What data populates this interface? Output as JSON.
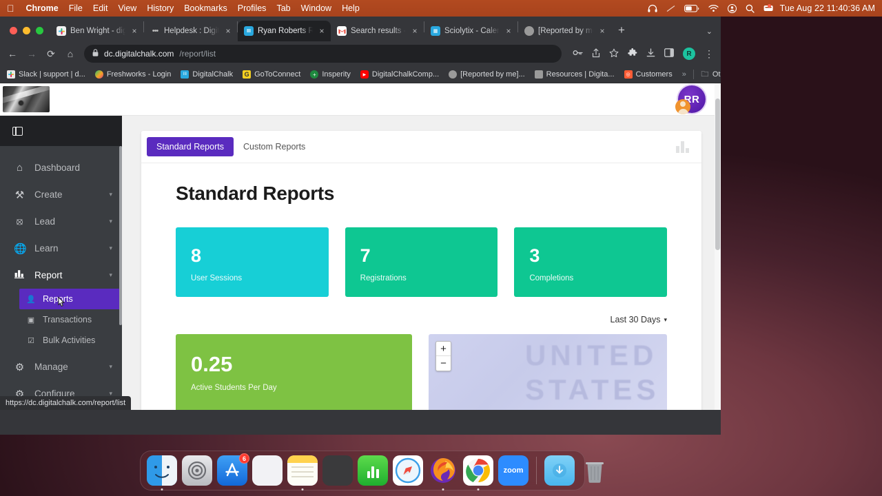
{
  "menubar": {
    "apple": "",
    "items": [
      "Chrome",
      "File",
      "Edit",
      "View",
      "History",
      "Bookmarks",
      "Profiles",
      "Tab",
      "Window",
      "Help"
    ],
    "status_icons": [
      "headphones-icon",
      "screen-mirroring-icon",
      "battery-icon",
      "wifi-icon",
      "control-center-icon",
      "spotlight-search-icon",
      "notification-center-icon"
    ],
    "clock": "Tue Aug 22  11:40:36 AM"
  },
  "browser": {
    "tabs": [
      {
        "title": "Ben Wright - digitalchalk",
        "favicon": "slack-icon",
        "active": false
      },
      {
        "title": "Helpdesk : DigitalChalk",
        "favicon": "freshworks-icon",
        "active": false
      },
      {
        "title": "Ryan Roberts Reports",
        "favicon": "digitalchalk-icon",
        "active": true
      },
      {
        "title": "Search results - ryan.rob",
        "favicon": "gmail-icon",
        "active": false
      },
      {
        "title": "Sciolytix - Calendar - Au",
        "favicon": "calendar-icon",
        "active": false
      },
      {
        "title": "[Reported by me] Issue",
        "favicon": "jira-icon",
        "active": false
      }
    ],
    "new_tab_label": "+",
    "tab_list_caret": "⌄",
    "nav": {
      "back": "←",
      "forward": "→",
      "reload": "⟳",
      "home": "⌂"
    },
    "omnibox": {
      "lock": "lock-icon",
      "host": "dc.digitalchalk.com",
      "path": "/report/list",
      "full_url": "https://dc.digitalchalk.com/report/list"
    },
    "toolbar_icons": [
      "password-key-icon",
      "share-icon",
      "bookmark-star-icon",
      "extensions-puzzle-icon",
      "downloads-icon",
      "side-panel-icon"
    ],
    "profile_initial": "R",
    "menu_icon": "three-dot-menu-icon",
    "bookmarks": [
      {
        "label": "Slack | support | d...",
        "icon": "slack-icon",
        "color": "#e0e0e0"
      },
      {
        "label": "Freshworks - Login",
        "icon": "freshworks-icon",
        "color": "#f5a623"
      },
      {
        "label": "DigitalChalk",
        "icon": "digitalchalk-icon",
        "color": "#29a8df"
      },
      {
        "label": "GoToConnect",
        "icon": "gotoconnect-icon",
        "color": "#f5d020"
      },
      {
        "label": "Insperity",
        "icon": "insperity-icon",
        "color": "#1f8a3f"
      },
      {
        "label": "DigitalChalkComp...",
        "icon": "youtube-icon",
        "color": "#ff0000"
      },
      {
        "label": "[Reported by me]...",
        "icon": "jira-icon",
        "color": "#9a9a9a"
      },
      {
        "label": "Resources | Digita...",
        "icon": "page-icon",
        "color": "#9a9a9a"
      },
      {
        "label": "Customers",
        "icon": "hubspot-icon",
        "color": "#ff5c35"
      }
    ],
    "bookmarks_overflow": "»",
    "other_bookmarks": {
      "label": "Other Bookmarks",
      "icon": "folder-icon"
    },
    "status_bubble": "https://dc.digitalchalk.com/report/list"
  },
  "app": {
    "logo_alt": "guitar-logo",
    "avatar": {
      "initials": "RR",
      "badge": "user-avatar-icon"
    },
    "sidebar": {
      "toggle_icon": "panel-toggle-icon",
      "items": [
        {
          "label": "Dashboard",
          "icon": "home-icon",
          "expandable": false
        },
        {
          "label": "Create",
          "icon": "tools-icon",
          "expandable": true
        },
        {
          "label": "Lead",
          "icon": "target-icon",
          "expandable": true
        },
        {
          "label": "Learn",
          "icon": "globe-icon",
          "expandable": true
        },
        {
          "label": "Report",
          "icon": "bar-chart-icon",
          "expandable": true,
          "expanded": true
        }
      ],
      "report_children": [
        {
          "label": "Reports",
          "icon": "report-card-icon",
          "active": true
        },
        {
          "label": "Transactions",
          "icon": "transaction-icon",
          "active": false
        },
        {
          "label": "Bulk Activities",
          "icon": "checkbox-icon",
          "active": false
        }
      ],
      "items_after": [
        {
          "label": "Manage",
          "icon": "gear-icon",
          "expandable": true
        },
        {
          "label": "Configure",
          "icon": "gear-settings-icon",
          "expandable": true
        }
      ],
      "caret": "▾"
    },
    "tabs": [
      {
        "label": "Standard Reports",
        "active": true
      },
      {
        "label": "Custom Reports",
        "active": false
      }
    ],
    "tabs_right_icon": "bar-chart-icon",
    "page_title": "Standard Reports",
    "kpis": [
      {
        "value": "8",
        "label": "User Sessions",
        "color": "#17cfd6"
      },
      {
        "value": "7",
        "label": "Registrations",
        "color": "#0ec792"
      },
      {
        "value": "3",
        "label": "Completions",
        "color": "#0ec792"
      }
    ],
    "date_range": {
      "label": "Last 30 Days",
      "caret": "▾"
    },
    "active_students": {
      "value": "0.25",
      "label": "Active Students Per Day",
      "color": "#7ec243"
    },
    "map": {
      "label_line1": "UNITED",
      "label_line2": "STATES",
      "zoom_in": "+",
      "zoom_out": "−"
    }
  },
  "dock": {
    "items": [
      {
        "name": "finder",
        "label": "Finder",
        "badge": null
      },
      {
        "name": "system-settings",
        "label": "System Settings",
        "badge": null
      },
      {
        "name": "app-store",
        "label": "App Store",
        "badge": "6"
      },
      {
        "name": "launchpad",
        "label": "Launchpad",
        "badge": null
      },
      {
        "name": "notes",
        "label": "Notes",
        "badge": null
      },
      {
        "name": "calculator",
        "label": "Calculator",
        "badge": null
      },
      {
        "name": "numbers",
        "label": "Numbers",
        "badge": null
      },
      {
        "name": "safari",
        "label": "Safari",
        "badge": null
      },
      {
        "name": "firefox",
        "label": "Firefox",
        "badge": null
      },
      {
        "name": "chrome",
        "label": "Google Chrome",
        "badge": null
      },
      {
        "name": "zoom",
        "label": "zoom",
        "badge": null
      },
      {
        "name": "downloads-folder",
        "label": "Downloads",
        "badge": null
      },
      {
        "name": "trash",
        "label": "Trash",
        "badge": null
      }
    ]
  }
}
